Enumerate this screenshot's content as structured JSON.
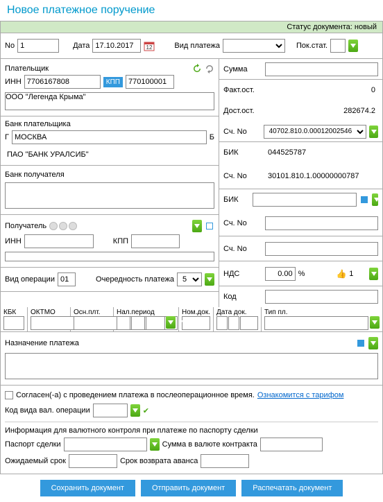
{
  "title": "Новое платежное поручение",
  "status": {
    "label": "Статус документа:",
    "value": "новый"
  },
  "row1": {
    "no_label": "No",
    "no_value": "1",
    "date_label": "Дата",
    "date_value": "17.10.2017",
    "paytype_label": "Вид платежа",
    "pokstat_label": "Пок.стат."
  },
  "payer": {
    "title": "Плательщик",
    "inn_label": "ИНН",
    "inn_value": "7706167808",
    "kpp_label": "КПП",
    "kpp_value": "770100001",
    "name": "ООО \"Легенда Крыма\"",
    "bank_title": "Банк плательщика",
    "city_label": "Г",
    "city_value": "МОСКВА",
    "city_suffix": "Б",
    "bank_name": "ПАО \"БАНК УРАЛСИБ\""
  },
  "recipient_bank": {
    "title": "Банк получателя"
  },
  "recipient": {
    "title": "Получатель",
    "inn_label": "ИНН",
    "kpp_label": "КПП"
  },
  "optype": {
    "label": "Вид операции",
    "value": "01",
    "priority_label": "Очередность платежа",
    "priority_value": "5"
  },
  "right": {
    "sum_label": "Сумма",
    "fact_label": "Факт.ост.",
    "fact_value": "0",
    "dost_label": "Дост.ост.",
    "dost_value": "282674.2",
    "sch_label": "Сч. No",
    "sch_value": "40702.810.0.00012002546",
    "bik_label": "БИК",
    "bik_value": "044525787",
    "sch2_label": "Сч. No",
    "sch2_value": "30101.810.1.00000000787",
    "bik2_label": "БИК",
    "sch3_label": "Сч. No",
    "sch4_label": "Сч. No",
    "nds_label": "НДС",
    "nds_value": "0.00",
    "nds_pct": "%",
    "nds_thumb": "1",
    "kod_label": "Код"
  },
  "grid": {
    "kbk": "КБК",
    "oktmo": "ОКТМО",
    "osn": "Осн.плт.",
    "nalper": "Нал.период",
    "nomdok": "Ном.док.",
    "datadok": "Дата док.",
    "tippl": "Тип пл."
  },
  "purpose": {
    "label": "Назначение платежа"
  },
  "consent": {
    "text": "Согласен(-а) с проведением платежа в послеоперационное время.",
    "link": "Ознакомится с тарифом"
  },
  "valop": {
    "label": "Код вида вал. операции"
  },
  "valinfo": {
    "title": "Информация для валютного контроля при платеже по паспорту сделки",
    "passport": "Паспорт сделки",
    "sum": "Сумма в валюте контракта",
    "expected": "Ожидаемый срок",
    "return": "Срок возврата аванса"
  },
  "buttons": {
    "save": "Сохранить документ",
    "send": "Отправить документ",
    "print": "Распечатать документ"
  }
}
